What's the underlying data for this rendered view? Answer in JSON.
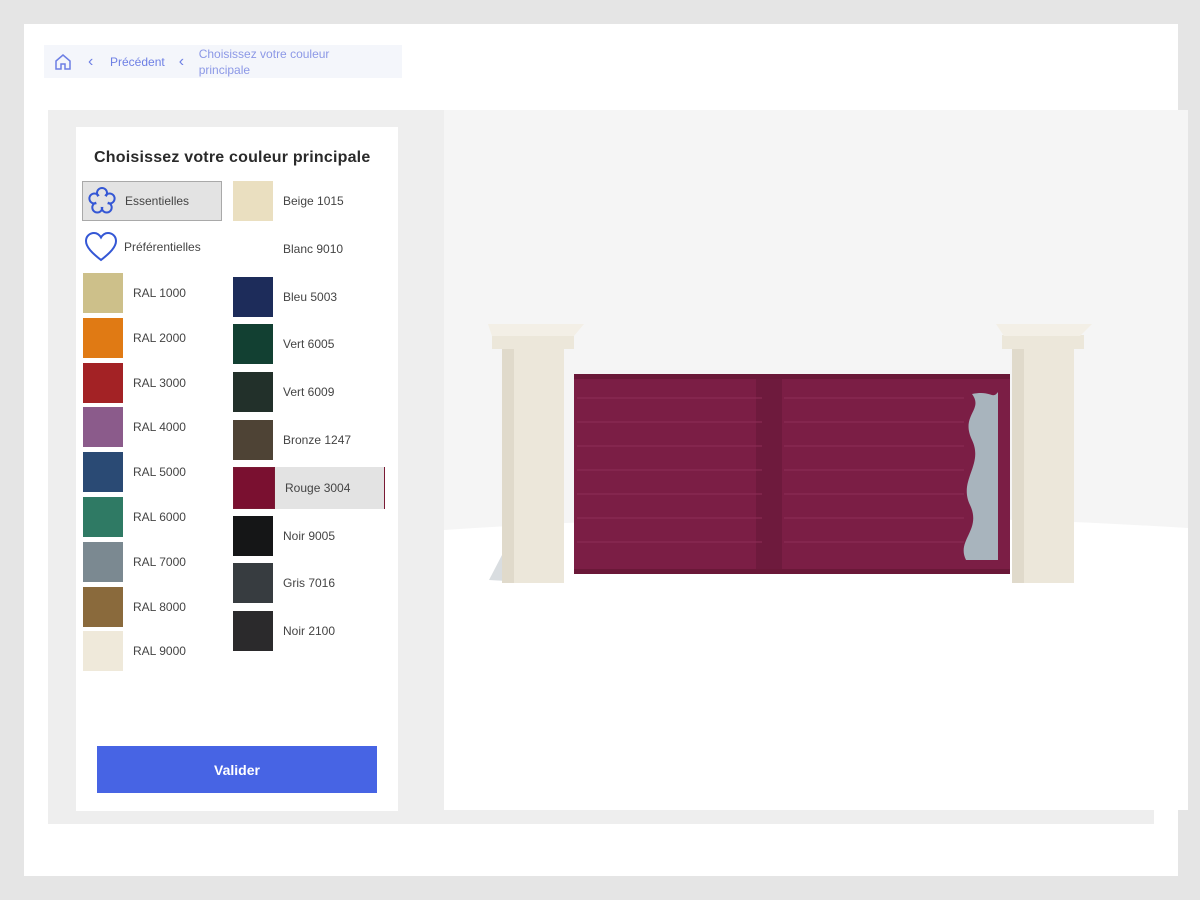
{
  "breadcrumb": {
    "home_icon": "home-icon",
    "previous_label": "Précédent",
    "current_label": "Choisissez votre couleur principale"
  },
  "panel": {
    "title": "Choisissez votre couleur principale",
    "categories": [
      {
        "label": "Essentielles",
        "icon": "flower-icon",
        "active": true
      },
      {
        "label": "Préférentielles",
        "icon": "heart-icon",
        "active": false
      }
    ],
    "left_swatches": [
      {
        "label": "RAL 1000",
        "color": "#cdc08a"
      },
      {
        "label": "RAL 2000",
        "color": "#e07a14"
      },
      {
        "label": "RAL 3000",
        "color": "#a32225"
      },
      {
        "label": "RAL 4000",
        "color": "#8b5b8b"
      },
      {
        "label": "RAL 5000",
        "color": "#2a4a74"
      },
      {
        "label": "RAL 6000",
        "color": "#2f7a64"
      },
      {
        "label": "RAL 7000",
        "color": "#7b8991"
      },
      {
        "label": "RAL 8000",
        "color": "#8a6a3c"
      },
      {
        "label": "RAL 9000",
        "color": "#efe9da"
      }
    ],
    "right_swatches": [
      {
        "label": "Beige 1015",
        "color": "#eadfc0"
      },
      {
        "label": "Blanc 9010",
        "color": "#ffffff"
      },
      {
        "label": "Bleu 5003",
        "color": "#1d2c5a"
      },
      {
        "label": "Vert 6005",
        "color": "#124032"
      },
      {
        "label": "Vert 6009",
        "color": "#22302a"
      },
      {
        "label": "Bronze 1247",
        "color": "#4e4335"
      },
      {
        "label": "Rouge 3004",
        "color": "#7a1030",
        "selected": true
      },
      {
        "label": "Noir 9005",
        "color": "#151617"
      },
      {
        "label": "Gris 7016",
        "color": "#373c40"
      },
      {
        "label": "Noir 2100",
        "color": "#2b2a2c"
      }
    ],
    "validate_label": "Valider"
  },
  "preview": {
    "gate_color": "#7b1e45",
    "pillar_color": "#ece7da",
    "insert_color": "#a8b4bd"
  }
}
